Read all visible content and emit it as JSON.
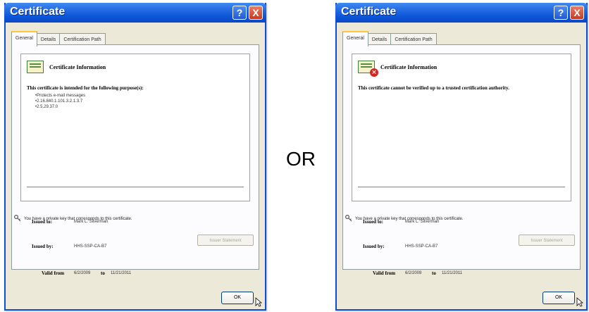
{
  "or_text": "OR",
  "dialogs": [
    {
      "title": "Certificate",
      "help_btn": "?",
      "close_btn": "X",
      "tabs": [
        "General",
        "Details",
        "Certification Path"
      ],
      "info_title": "Certificate Information",
      "message": "This certificate is intended for the following purpose(s):",
      "bullets": [
        "•Protects e-mail messages",
        "•2.16.840.1.101.3.2.1.3.7",
        "•2.5.29.37.0"
      ],
      "issued_to_label": "Issued to:",
      "issued_to": "Mark L. Silverman",
      "issued_by_label": "Issued by:",
      "issued_by": "HHS-SSP-CA-B7",
      "valid_from_label": "Valid from",
      "valid_from": "6/2/2009",
      "to_label": "to",
      "valid_to": "11/21/2011",
      "key_message": "You have a private key that corresponds to this certificate.",
      "issuer_statement": "Issuer Statement",
      "ok": "OK",
      "icon": "certificate-icon"
    },
    {
      "title": "Certificate",
      "help_btn": "?",
      "close_btn": "X",
      "tabs": [
        "General",
        "Details",
        "Certification Path"
      ],
      "info_title": "Certificate Information",
      "message": "This certificate cannot be verified up to a trusted certification authority.",
      "issued_to_label": "Issued to:",
      "issued_to": "Mark L. Silverman",
      "issued_by_label": "Issued by:",
      "issued_by": "HHS-SSP-CA-B7",
      "valid_from_label": "Valid from",
      "valid_from": "6/2/2009",
      "to_label": "to",
      "valid_to": "11/21/2011",
      "key_message": "You have a private key that corresponds to this certificate.",
      "issuer_statement": "Issuer Statement",
      "ok": "OK",
      "icon": "certificate-error-icon"
    }
  ]
}
